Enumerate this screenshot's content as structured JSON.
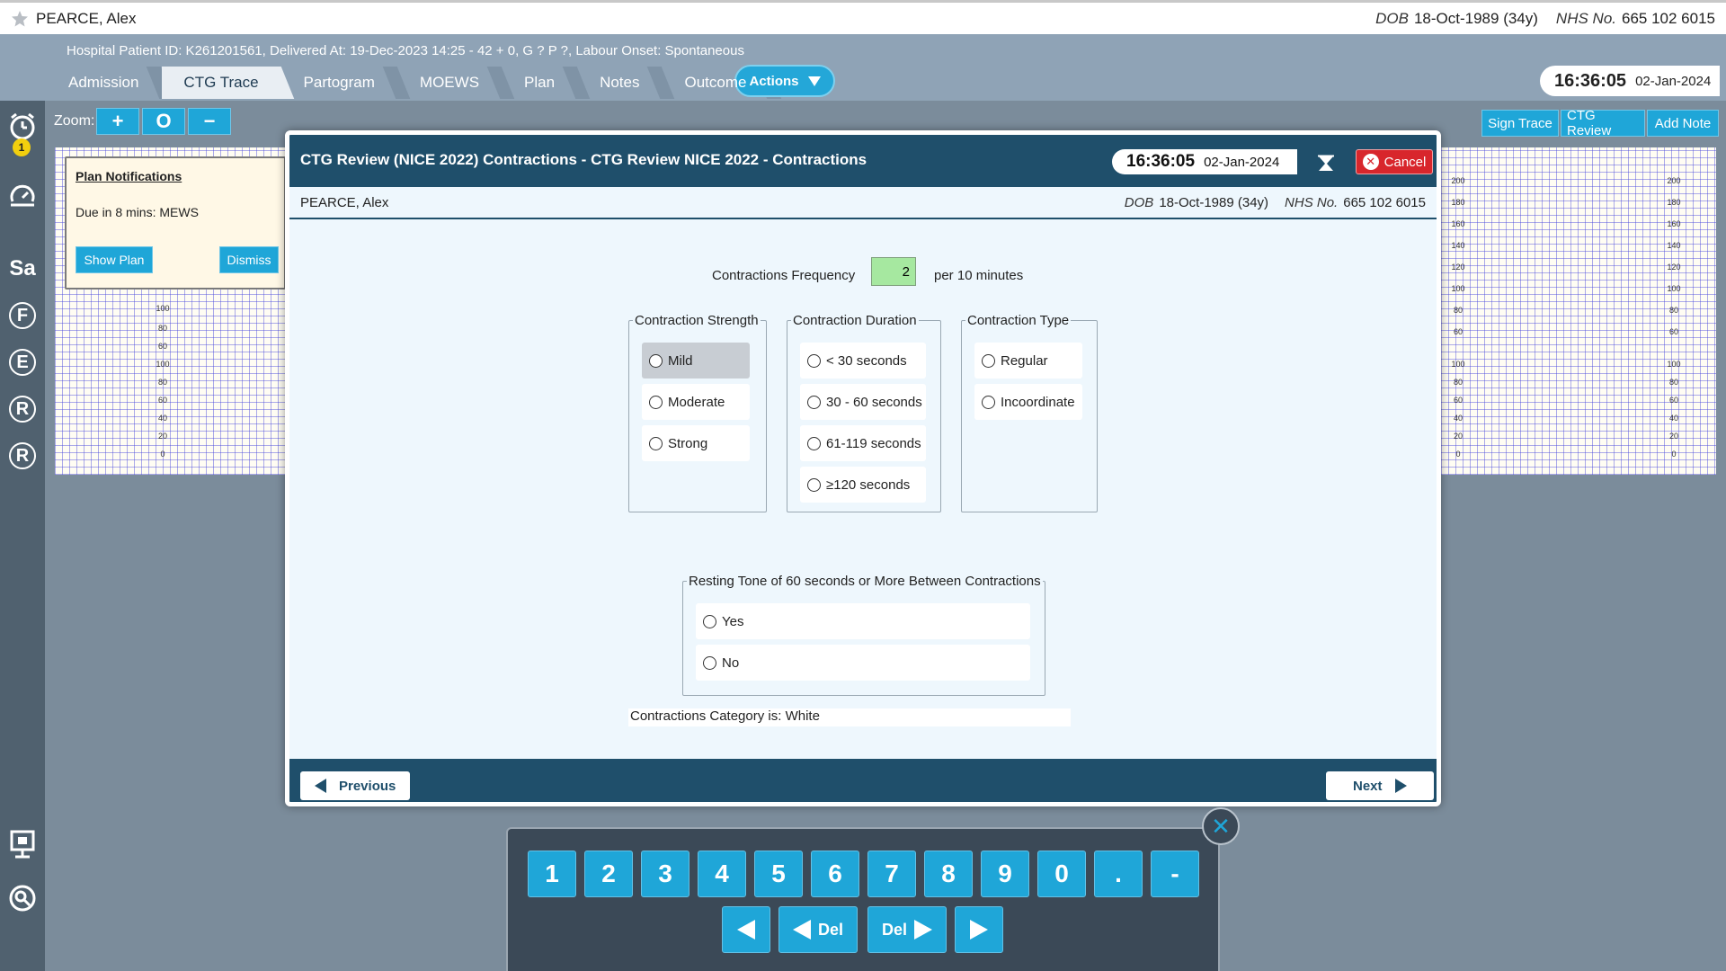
{
  "patient": {
    "name": "PEARCE, Alex",
    "dob_label": "DOB",
    "dob": "18-Oct-1989 (34y)",
    "nhs_label": "NHS No.",
    "nhs": "665 102 6015"
  },
  "episode": "Hospital Patient ID: K261201561, Delivered At: 19-Dec-2023 14:25 - 42 + 0, G ? P ?,   Labour Onset: Spontaneous",
  "tabs": [
    "Admission",
    "CTG Trace",
    "Partogram",
    "MOEWS",
    "Plan",
    "Notes",
    "Outcome"
  ],
  "active_tab": "CTG Trace",
  "actions_label": "Actions",
  "clock": {
    "time": "16:36:05",
    "date": "02-Jan-2024"
  },
  "sidebar": {
    "badge": "1",
    "letters": [
      "Sa",
      "F",
      "E",
      "R",
      "R"
    ]
  },
  "zoom": {
    "label": "Zoom:",
    "plus": "+",
    "reset": "O",
    "minus": "−"
  },
  "right_buttons": [
    "Sign Trace",
    "CTG Review",
    "Add Note"
  ],
  "trace_scale_top": [
    "200",
    "180",
    "160",
    "140",
    "120",
    "100",
    "80",
    "60"
  ],
  "trace_scale_left_partial": [
    "100",
    "80",
    "60"
  ],
  "trace_scale_bottom": [
    "100",
    "80",
    "60",
    "40",
    "20",
    "0"
  ],
  "notifications": {
    "title": "Plan Notifications",
    "message": "Due in 8 mins: MEWS",
    "show_label": "Show Plan",
    "dismiss_label": "Dismiss"
  },
  "modal": {
    "title": "CTG Review (NICE 2022) Contractions - CTG Review NICE 2022 - Contractions",
    "cancel_label": "Cancel",
    "frequency_label": "Contractions Frequency",
    "frequency_value": "2",
    "frequency_unit": "per 10 minutes",
    "strength": {
      "legend": "Contraction Strength",
      "options": [
        "Mild",
        "Moderate",
        "Strong"
      ],
      "highlighted": "Mild"
    },
    "duration": {
      "legend": "Contraction Duration",
      "options": [
        "< 30 seconds",
        "30 - 60 seconds",
        "61-119 seconds",
        "≥120 seconds"
      ]
    },
    "type": {
      "legend": "Contraction Type",
      "options": [
        "Regular",
        "Incoordinate"
      ]
    },
    "resting": {
      "legend": "Resting Tone of 60 seconds or More Between Contractions",
      "options": [
        "Yes",
        "No"
      ]
    },
    "category": "Contractions Category is: White",
    "previous_label": "Previous",
    "next_label": "Next"
  },
  "keypad": {
    "keys": [
      "1",
      "2",
      "3",
      "4",
      "5",
      "6",
      "7",
      "8",
      "9",
      "0",
      ".",
      "-"
    ],
    "del_label": "Del"
  }
}
